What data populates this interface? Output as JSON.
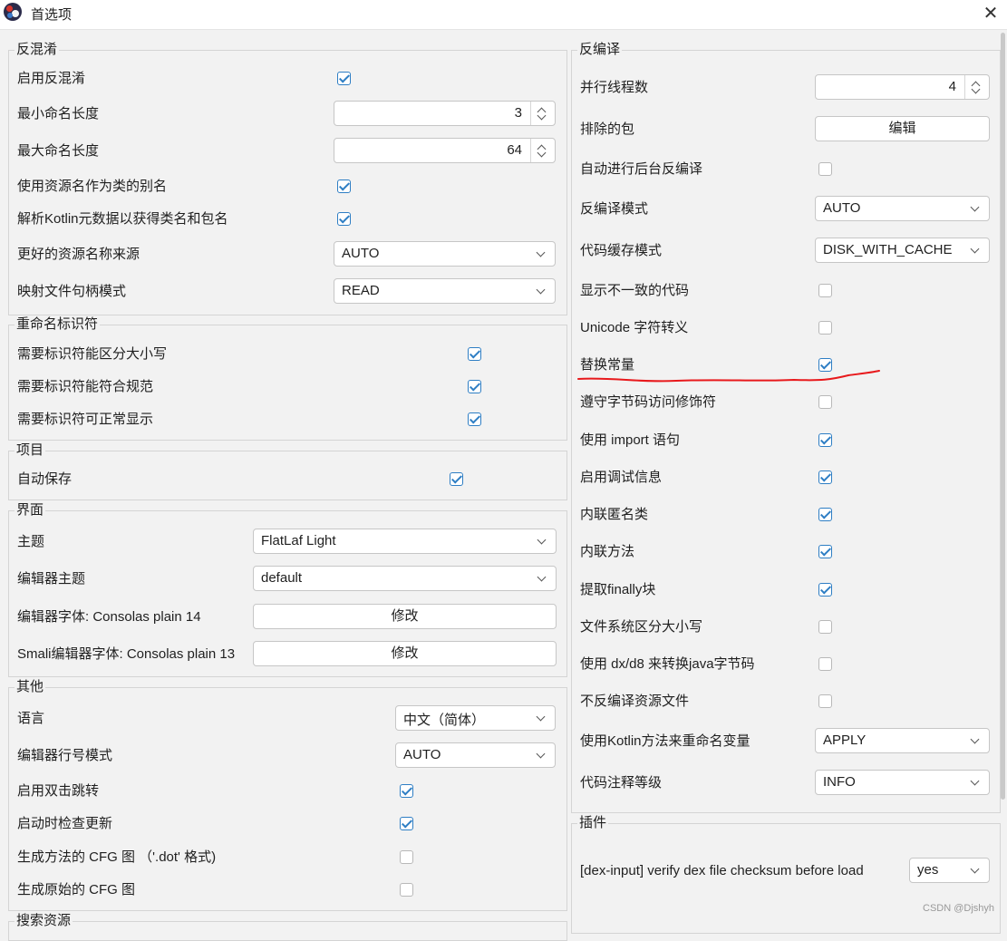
{
  "window": {
    "title": "首选项"
  },
  "left": {
    "deobfuscation": {
      "title": "反混淆",
      "enable_label": "启用反混淆",
      "min_len_label": "最小命名长度",
      "min_len_value": "3",
      "max_len_label": "最大命名长度",
      "max_len_value": "64",
      "use_source_name_label": "使用资源名作为类的别名",
      "kotlin_meta_label": "解析Kotlin元数据以获得类名和包名",
      "better_res_label": "更好的资源名称来源",
      "better_res_value": "AUTO",
      "map_file_label": "映射文件句柄模式",
      "map_file_value": "READ"
    },
    "rename": {
      "title": "重命名标识符",
      "case_label": "需要标识符能区分大小写",
      "valid_label": "需要标识符能符合规范",
      "printable_label": "需要标识符可正常显示"
    },
    "project": {
      "title": "项目",
      "autosave_label": "自动保存"
    },
    "ui": {
      "title": "界面",
      "theme_label": "主题",
      "theme_value": "FlatLaf Light",
      "editor_theme_label": "编辑器主题",
      "editor_theme_value": "default",
      "editor_font_label": "编辑器字体: Consolas plain 14",
      "smali_font_label": "Smali编辑器字体: Consolas plain 13",
      "modify_label": "修改"
    },
    "other": {
      "title": "其他",
      "language_label": "语言",
      "language_value": "中文（简体）",
      "line_mode_label": "编辑器行号模式",
      "line_mode_value": "AUTO",
      "jump_label": "启用双击跳转",
      "update_label": "启动时检查更新",
      "cfg_dot_label": "生成方法的 CFG 图 （'.dot' 格式)",
      "cfg_raw_label": "生成原始的 CFG 图"
    },
    "search": {
      "title": "搜索资源"
    }
  },
  "right": {
    "decompile": {
      "title": "反编译",
      "threads_label": "并行线程数",
      "threads_value": "4",
      "excluded_label": "排除的包",
      "edit_label": "编辑",
      "auto_bg_label": "自动进行后台反编译",
      "mode_label": "反编译模式",
      "mode_value": "AUTO",
      "cache_label": "代码缓存模式",
      "cache_value": "DISK_WITH_CACHE",
      "inconsistent_label": "显示不一致的代码",
      "unicode_label": "Unicode 字符转义",
      "replace_const_label": "替换常量",
      "respect_access_label": "遵守字节码访问修饰符",
      "import_label": "使用 import 语句",
      "debug_label": "启用调试信息",
      "inline_anon_label": "内联匿名类",
      "inline_methods_label": "内联方法",
      "finally_label": "提取finally块",
      "fs_case_label": "文件系统区分大小写",
      "dx_label": "使用 dx/d8 来转换java字节码",
      "skip_res_label": "不反编译资源文件",
      "kotlin_rename_label": "使用Kotlin方法来重命名变量",
      "kotlin_rename_value": "APPLY",
      "comment_label": "代码注释等级",
      "comment_value": "INFO"
    },
    "plugins": {
      "title": "插件",
      "dex_label": "[dex-input]  verify dex file checksum before load",
      "dex_value": "yes"
    }
  },
  "watermark": "CSDN @Djshyh",
  "colors": {
    "accent": "#2e7ec4",
    "annotation": "#e8191c"
  }
}
